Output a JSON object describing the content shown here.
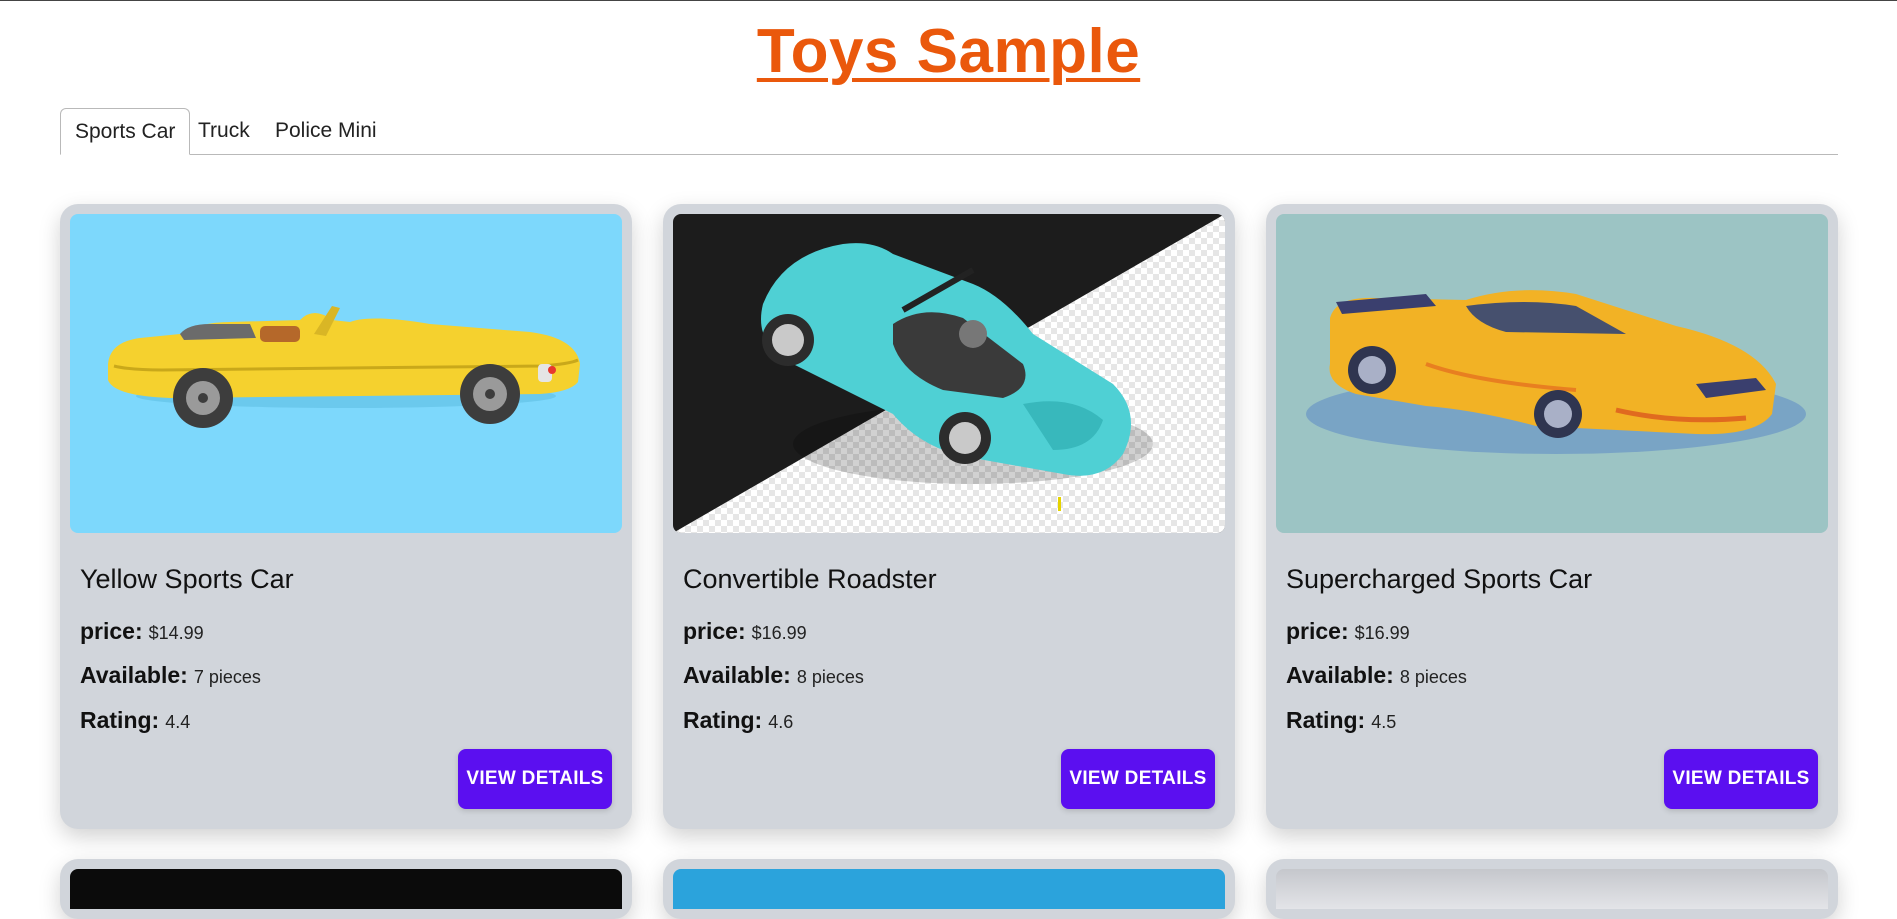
{
  "page": {
    "title": "Toys Sample"
  },
  "tabs": [
    {
      "label": "Sports Car",
      "active": true
    },
    {
      "label": "Truck",
      "active": false
    },
    {
      "label": "Police Mini",
      "active": false
    }
  ],
  "labels": {
    "price": "price:",
    "available": "Available:",
    "rating": "Rating:",
    "button": "VIEW DETAILS"
  },
  "cards": [
    {
      "title": "Yellow Sports Car",
      "price": "$14.99",
      "available": "7 pieces",
      "rating": "4.4",
      "image": "yellow-convertible-image",
      "image_bg": "#7dd8fc"
    },
    {
      "title": "Convertible Roadster",
      "price": "$16.99",
      "available": "8 pieces",
      "rating": "4.6",
      "image": "turquoise-roadster-image",
      "image_bg": "#1c1c1c"
    },
    {
      "title": "Supercharged Sports Car",
      "price": "$16.99",
      "available": "8 pieces",
      "rating": "4.5",
      "image": "orange-supercar-image",
      "image_bg": "#9cc4c4"
    }
  ],
  "colors": {
    "title": "#ea580c",
    "button": "#5b0ff0",
    "card": "#d1d5db"
  }
}
